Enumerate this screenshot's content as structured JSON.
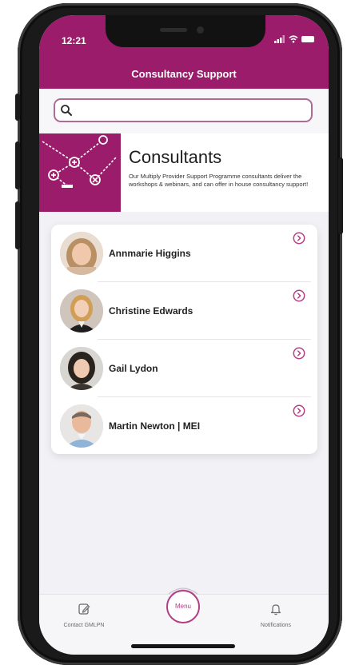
{
  "status_bar": {
    "time": "12:21"
  },
  "header": {
    "title": "Consultancy Support"
  },
  "search": {
    "placeholder": "",
    "value": ""
  },
  "banner": {
    "title": "Consultants",
    "description": "Our Multiply Provider Support Programme consultants deliver the workshops & webinars, and can offer in house consultancy support!"
  },
  "consultants": [
    {
      "name": "Annmarie Higgins"
    },
    {
      "name": "Christine Edwards"
    },
    {
      "name": "Gail Lydon"
    },
    {
      "name": "Martin Newton | MEI"
    }
  ],
  "tabbar": {
    "left_label": "Contact GMLPN",
    "center_label": "Menu",
    "right_label": "Notifications"
  },
  "colors": {
    "brand": "#9a1c6a",
    "accent": "#b23f86",
    "background": "#f2f1f5"
  },
  "icons": [
    "search-icon",
    "chevron-right-circle-icon",
    "edit-icon",
    "bell-icon",
    "signal-icon",
    "wifi-icon",
    "battery-icon"
  ]
}
